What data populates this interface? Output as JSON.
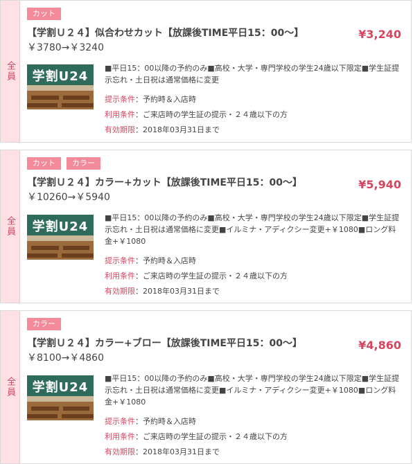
{
  "coupons": [
    {
      "side_label": "全員",
      "tags": [
        "カット"
      ],
      "title": "【学割Ｕ２４】似合わせカット【放課後TIME平日15：00～】",
      "price_line": "￥3780→￥3240",
      "price": "¥3,240",
      "thumb_text": "学割U24",
      "description": "■平日15：00以降の予約のみ■高校・大学・専門学校の学生24歳以下限定■学生証提示忘れ・土日祝は通常価格に変更",
      "present_label": "提示条件",
      "present_value": "：予約時＆入店時",
      "use_label": "利用条件",
      "use_value": "：ご来店時の学生証の提示・２４歳以下の方",
      "expiry_label": "有効期限",
      "expiry_value": "：2018年03月31日まで"
    },
    {
      "side_label": "全員",
      "tags": [
        "カット",
        "カラー"
      ],
      "title": "【学割Ｕ２４】カラー+カット【放課後TIME平日15：00～】",
      "price_line": "￥10260→￥5940",
      "price": "¥5,940",
      "thumb_text": "学割U24",
      "description": "■平日15：00以降の予約のみ■高校・大学・専門学校の学生24歳以下限定■学生証提示忘れ・土日祝は通常価格に変更■イルミナ・アディクシー変更+￥1080■ロング料金+￥1080",
      "present_label": "提示条件",
      "present_value": "：予約時＆入店時",
      "use_label": "利用条件",
      "use_value": "：ご来店時の学生証の提示・２４歳以下の方",
      "expiry_label": "有効期限",
      "expiry_value": "：2018年03月31日まで"
    },
    {
      "side_label": "全員",
      "tags": [
        "カラー"
      ],
      "title": "【学割Ｕ２４】カラー+ブロー【放課後TIME平日15：00～】",
      "price_line": "￥8100→￥4860",
      "price": "¥4,860",
      "thumb_text": "学割U24",
      "description": "■平日15：00以降の予約のみ■高校・大学・専門学校の学生24歳以下限定■学生証提示忘れ・土日祝は通常価格に変更■イルミナ・アディクシー変更+￥1080■ロング料金+￥1080",
      "present_label": "提示条件",
      "present_value": "：予約時＆入店時",
      "use_label": "利用条件",
      "use_value": "：ご来店時の学生証の提示・２４歳以下の方",
      "expiry_label": "有効期限",
      "expiry_value": "：2018年03月31日まで"
    }
  ]
}
